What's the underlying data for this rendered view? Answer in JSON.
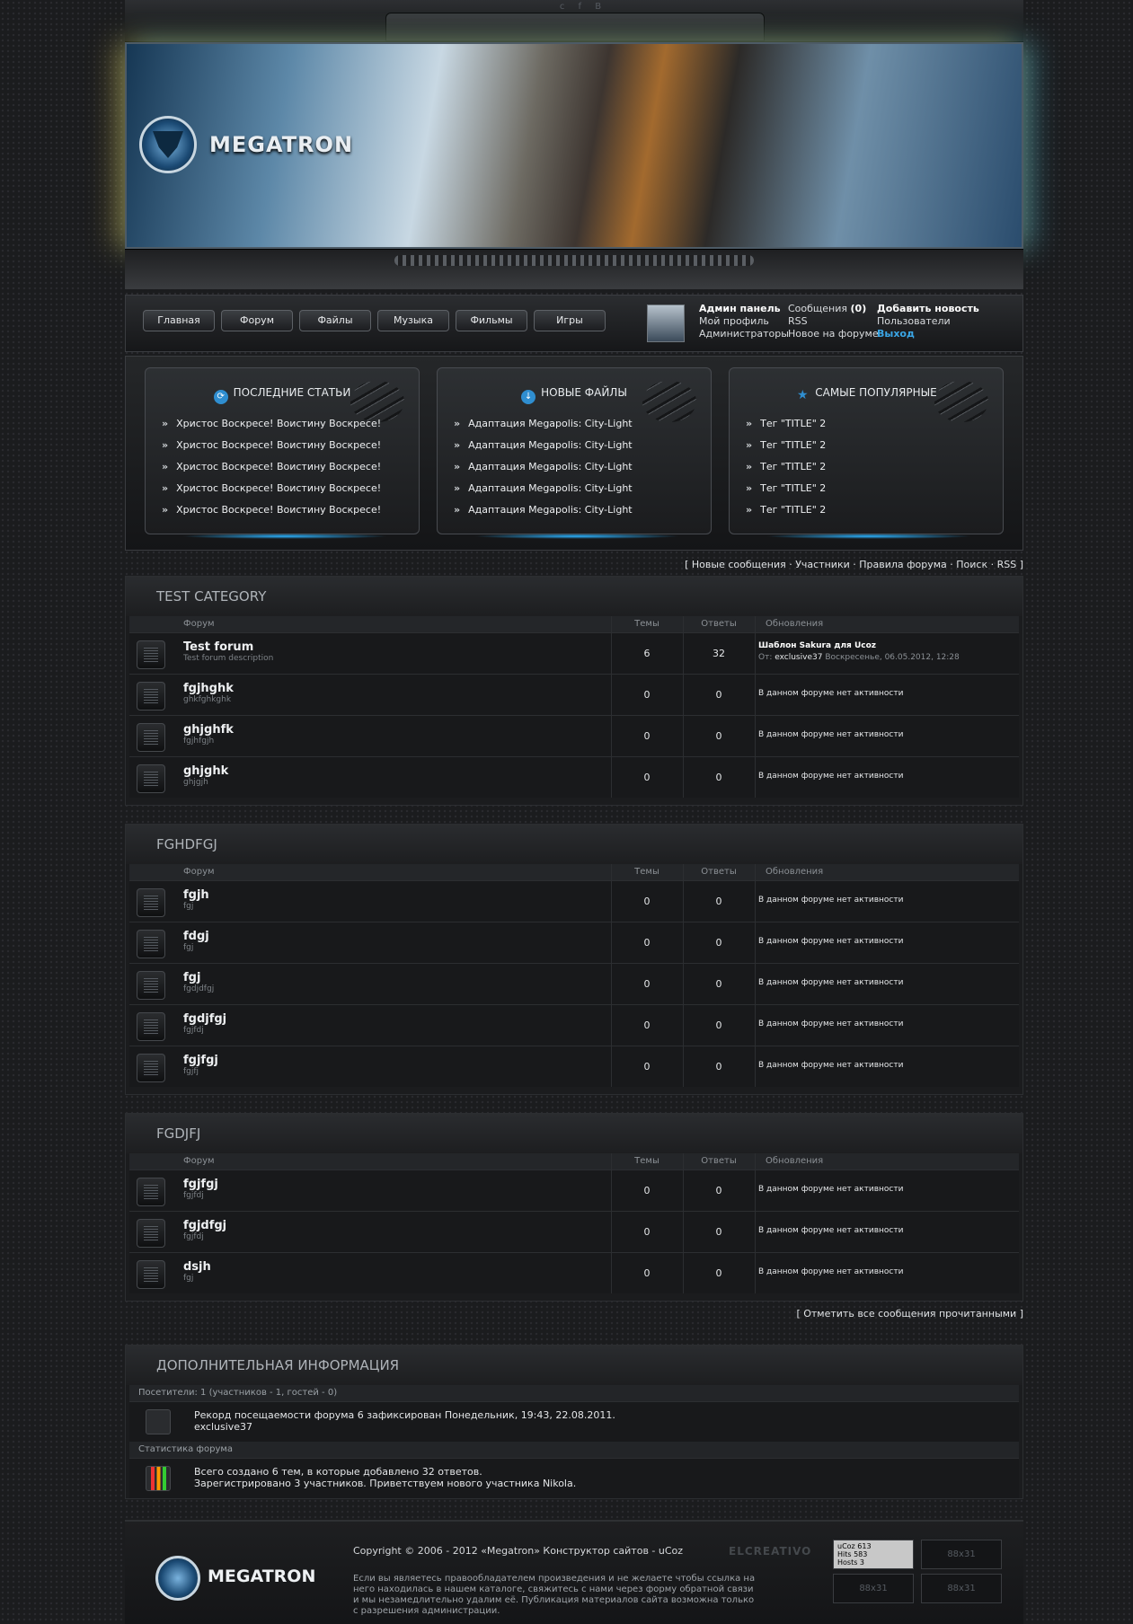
{
  "site": {
    "title": "MEGATRON",
    "social": "c f B"
  },
  "nav": [
    "Главная",
    "Форум",
    "Файлы",
    "Музыка",
    "Фильмы",
    "Игры"
  ],
  "user": {
    "col1": [
      "Админ панель",
      "Мой профиль",
      "Администраторы"
    ],
    "col2_messages_label": "Сообщения",
    "col2_messages_count": "(0)",
    "col2": [
      "RSS",
      "Новое на форуме"
    ],
    "col3": [
      "Добавить новость",
      "Пользователи",
      "Выход"
    ]
  },
  "blocks": [
    {
      "title": "ПОСЛЕДНИЕ СТАТЬИ",
      "icon": "refresh-icon",
      "items": [
        "Христос Воскресе! Воистину Воскресе!",
        "Христос Воскресе! Воистину Воскресе!",
        "Христос Воскресе! Воистину Воскресе!",
        "Христос Воскресе! Воистину Воскресе!",
        "Христос Воскресе! Воистину Воскресе!"
      ]
    },
    {
      "title": "НОВЫЕ ФАЙЛЫ",
      "icon": "download-icon",
      "items": [
        "Адаптация Megapolis: City-Light",
        "Адаптация Megapolis: City-Light",
        "Адаптация Megapolis: City-Light",
        "Адаптация Megapolis: City-Light",
        "Адаптация Megapolis: City-Light"
      ]
    },
    {
      "title": "САМЫЕ ПОПУЛЯРНЫЕ",
      "icon": "star-icon",
      "items": [
        "Тег \"TITLE\" 2",
        "Тег \"TITLE\" 2",
        "Тег \"TITLE\" 2",
        "Тег \"TITLE\" 2",
        "Тег \"TITLE\" 2"
      ]
    }
  ],
  "quicklinks": "[ Новые сообщения · Участники · Правила форума · Поиск · RSS ]",
  "table_headers": {
    "forum": "Форум",
    "themes": "Темы",
    "answers": "Ответы",
    "updates": "Обновления"
  },
  "no_activity": "В данном форуме нет активности",
  "categories": [
    {
      "title": "TEST CATEGORY",
      "forums": [
        {
          "name": "Test forum",
          "desc": "Test forum description",
          "themes": "6",
          "answers": "32",
          "last_title": "Шаблон Sakura для Ucoz",
          "last_from": "От:",
          "last_user": "exclusive37",
          "last_date": "Воскресенье, 06.05.2012, 12:28"
        },
        {
          "name": "fgjhghk",
          "desc": "ghkfghkghk",
          "themes": "0",
          "answers": "0"
        },
        {
          "name": "ghjghfk",
          "desc": "fgjhfgjh",
          "themes": "0",
          "answers": "0"
        },
        {
          "name": "ghjghk",
          "desc": "ghjgjh",
          "themes": "0",
          "answers": "0"
        }
      ]
    },
    {
      "title": "FGHDFGJ",
      "forums": [
        {
          "name": "fgjh",
          "desc": "fgj",
          "themes": "0",
          "answers": "0"
        },
        {
          "name": "fdgj",
          "desc": "fgj",
          "themes": "0",
          "answers": "0"
        },
        {
          "name": "fgj",
          "desc": "fgdjdfgj",
          "themes": "0",
          "answers": "0"
        },
        {
          "name": "fgdjfgj",
          "desc": "fgjfdj",
          "themes": "0",
          "answers": "0"
        },
        {
          "name": "fgjfgj",
          "desc": "fgjfj",
          "themes": "0",
          "answers": "0"
        }
      ]
    },
    {
      "title": "FGDJFJ",
      "forums": [
        {
          "name": "fgjfgj",
          "desc": "fgjfdj",
          "themes": "0",
          "answers": "0"
        },
        {
          "name": "fgjdfgj",
          "desc": "fgjfdj",
          "themes": "0",
          "answers": "0"
        },
        {
          "name": "dsjh",
          "desc": "fgj",
          "themes": "0",
          "answers": "0"
        }
      ]
    }
  ],
  "mark_read": "[ Отметить все сообщения прочитанными ]",
  "info": {
    "title": "ДОПОЛНИТЕЛЬНАЯ ИНФОРМАЦИЯ",
    "visitors": "Посетители: 1  (участников - 1, гостей - 0)",
    "record_line": "Рекорд посещаемости форума 6 зафиксирован Понедельник, 19:43, 22.08.2011.",
    "record_user": "exclusive37",
    "stats_label": "Статистика форума",
    "stats_line1": "Всего создано 6 тем, в которые добавлено 32 ответов.",
    "stats_line2": "Зарегистрировано 3 участников. Приветствуем нового участника Nikola."
  },
  "footer": {
    "title": "MEGATRON",
    "copyright": "Copyright © 2006 - 2012 «Megatron» Конструктор сайтов - uCoz",
    "legal": "Если вы являетесь правообладателем произведения и не желаете чтобы ссылка на него находилась в нашем каталоге, свяжитесь с нами через форму обратной связи и мы незамедлительно удалим её. Публикация материалов сайта возможна только с разрешения администрации.",
    "designed": "ELCREATIVO",
    "ucoz_counter": [
      "uCoz 613",
      "Hits 583",
      "Hosts 3"
    ],
    "badge": "88x31"
  }
}
